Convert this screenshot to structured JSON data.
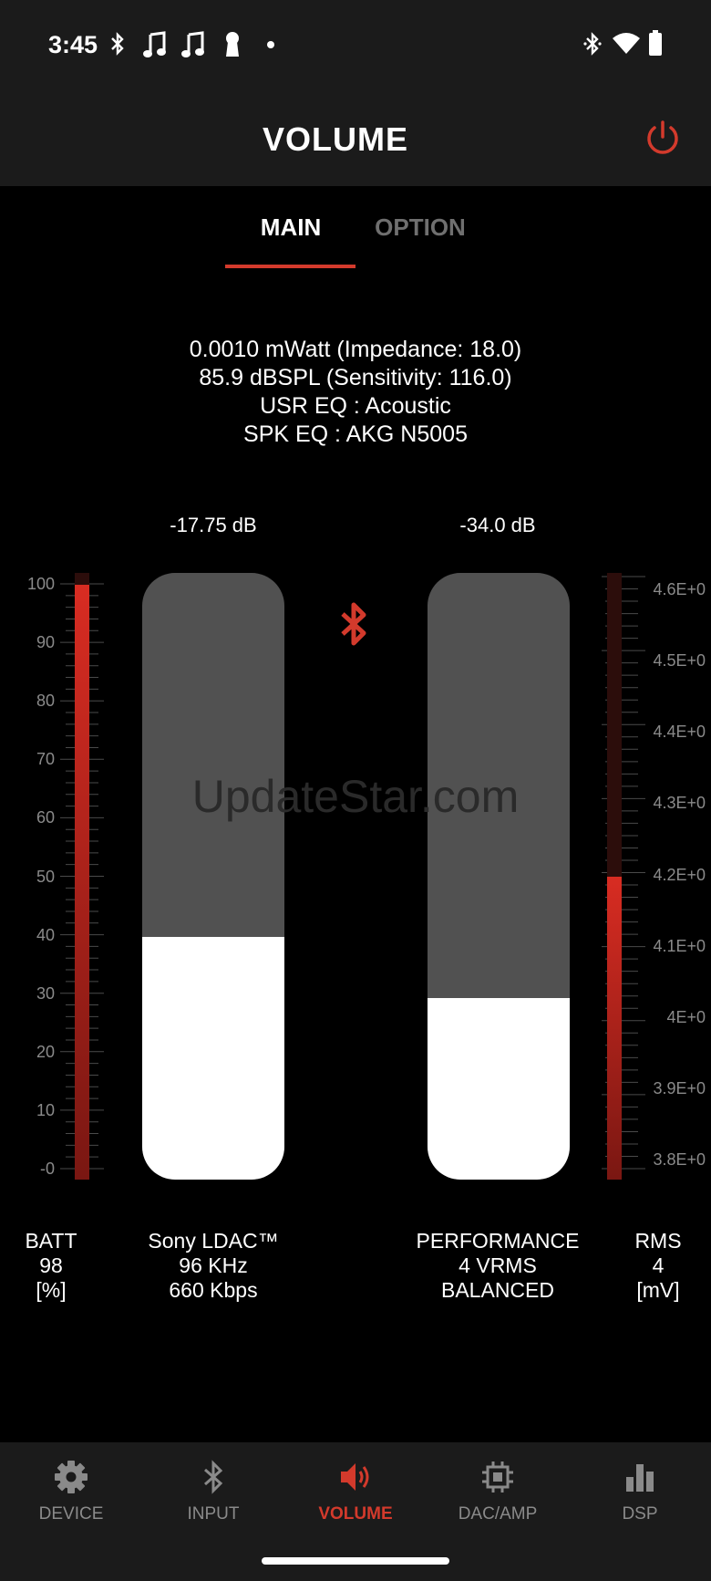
{
  "status_bar": {
    "time": "3:45"
  },
  "app_bar": {
    "title": "VOLUME"
  },
  "tabs": [
    {
      "label": "MAIN"
    },
    {
      "label": "OPTION"
    }
  ],
  "info": {
    "line1": "0.0010 mWatt (Impedance: 18.0)",
    "line2": "85.9 dBSPL (Sensitivity: 116.0)",
    "line3": "USR EQ : Acoustic",
    "line4": "SPK EQ : AKG N5005"
  },
  "volume_left": {
    "db_label": "-17.75 dB",
    "level": 0.4
  },
  "volume_right": {
    "db_label": "-34.0 dB",
    "level": 0.3
  },
  "battery_meter": {
    "ticks": [
      "100",
      "90",
      "80",
      "70",
      "60",
      "50",
      "40",
      "30",
      "20",
      "10",
      "-0"
    ],
    "value": 98
  },
  "rms_meter": {
    "ticks": [
      "4.6E+0",
      "4.5E+0",
      "4.4E+0",
      "4.3E+0",
      "4.2E+0",
      "4.1E+0",
      "4E+0",
      "3.9E+0",
      "3.8E+0"
    ],
    "level": 0.5
  },
  "footer": {
    "batt": {
      "label": "BATT",
      "value": "98",
      "unit": "[%]"
    },
    "codec": {
      "name": "Sony LDAC™",
      "rate": "96 KHz",
      "bitrate": "660 Kbps"
    },
    "performance": {
      "label": "PERFORMANCE",
      "vrms": "4 VRMS",
      "mode": "BALANCED"
    },
    "rms": {
      "label": "RMS",
      "value": "4",
      "unit": "[mV]"
    }
  },
  "watermark": "UpdateStar.com",
  "nav": [
    {
      "label": "DEVICE",
      "icon": "gear-icon"
    },
    {
      "label": "INPUT",
      "icon": "bluetooth-icon"
    },
    {
      "label": "VOLUME",
      "icon": "speaker-icon"
    },
    {
      "label": "DAC/AMP",
      "icon": "chip-icon"
    },
    {
      "label": "DSP",
      "icon": "bar-chart-icon"
    }
  ],
  "colors": {
    "accent": "#d33a2c",
    "bar_track": "#515151",
    "bar_fill": "#ffffff",
    "appbar": "#1b1b1b"
  }
}
